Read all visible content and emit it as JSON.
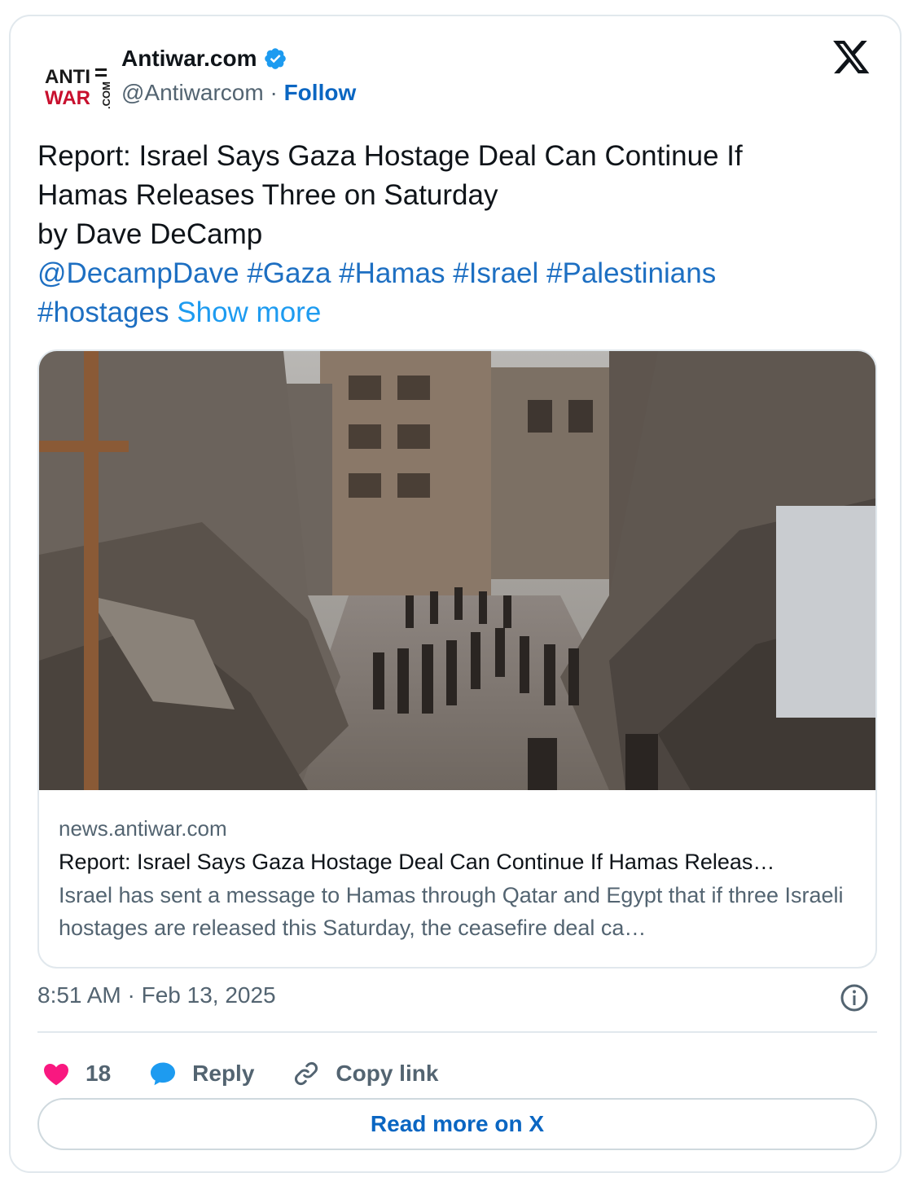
{
  "account": {
    "logo_text_top": "ANTI",
    "logo_text_bottom": "WAR",
    "logo_text_side": ".COM",
    "name": "Antiwar.com",
    "handle": "@Antiwarcom",
    "separator": "·",
    "follow_label": "Follow"
  },
  "tweet": {
    "line1": "Report: Israel Says Gaza Hostage Deal Can Continue If",
    "line2": "Hamas Releases Three on Saturday",
    "line3": "by Dave DeCamp",
    "mention": "@DecampDave",
    "hashtags": [
      "#Gaza",
      "#Hamas",
      "#Israel",
      "#Palestinians",
      "#hostages"
    ],
    "show_more": "Show more"
  },
  "link_card": {
    "domain": "news.antiwar.com",
    "title": "Report: Israel Says Gaza Hostage Deal Can Continue If Hamas Releas…",
    "description": "Israel has sent a message to Hamas through Qatar and Egypt that if three Israeli hostages are released this Saturday, the ceasefire deal ca…"
  },
  "timestamp": "8:51 AM · Feb 13, 2025",
  "actions": {
    "like_count": "18",
    "reply_label": "Reply",
    "copy_label": "Copy link"
  },
  "read_more_label": "Read more on X",
  "colors": {
    "accent": "#0a66c2",
    "hashtag": "#1d6fc2",
    "like": "#f91880",
    "reply": "#1d9bf0",
    "muted": "#536471",
    "border": "#e1e8ed"
  },
  "icons": [
    "verified-badge-icon",
    "x-logo-icon",
    "info-icon",
    "heart-icon",
    "reply-bubble-icon",
    "link-icon"
  ]
}
